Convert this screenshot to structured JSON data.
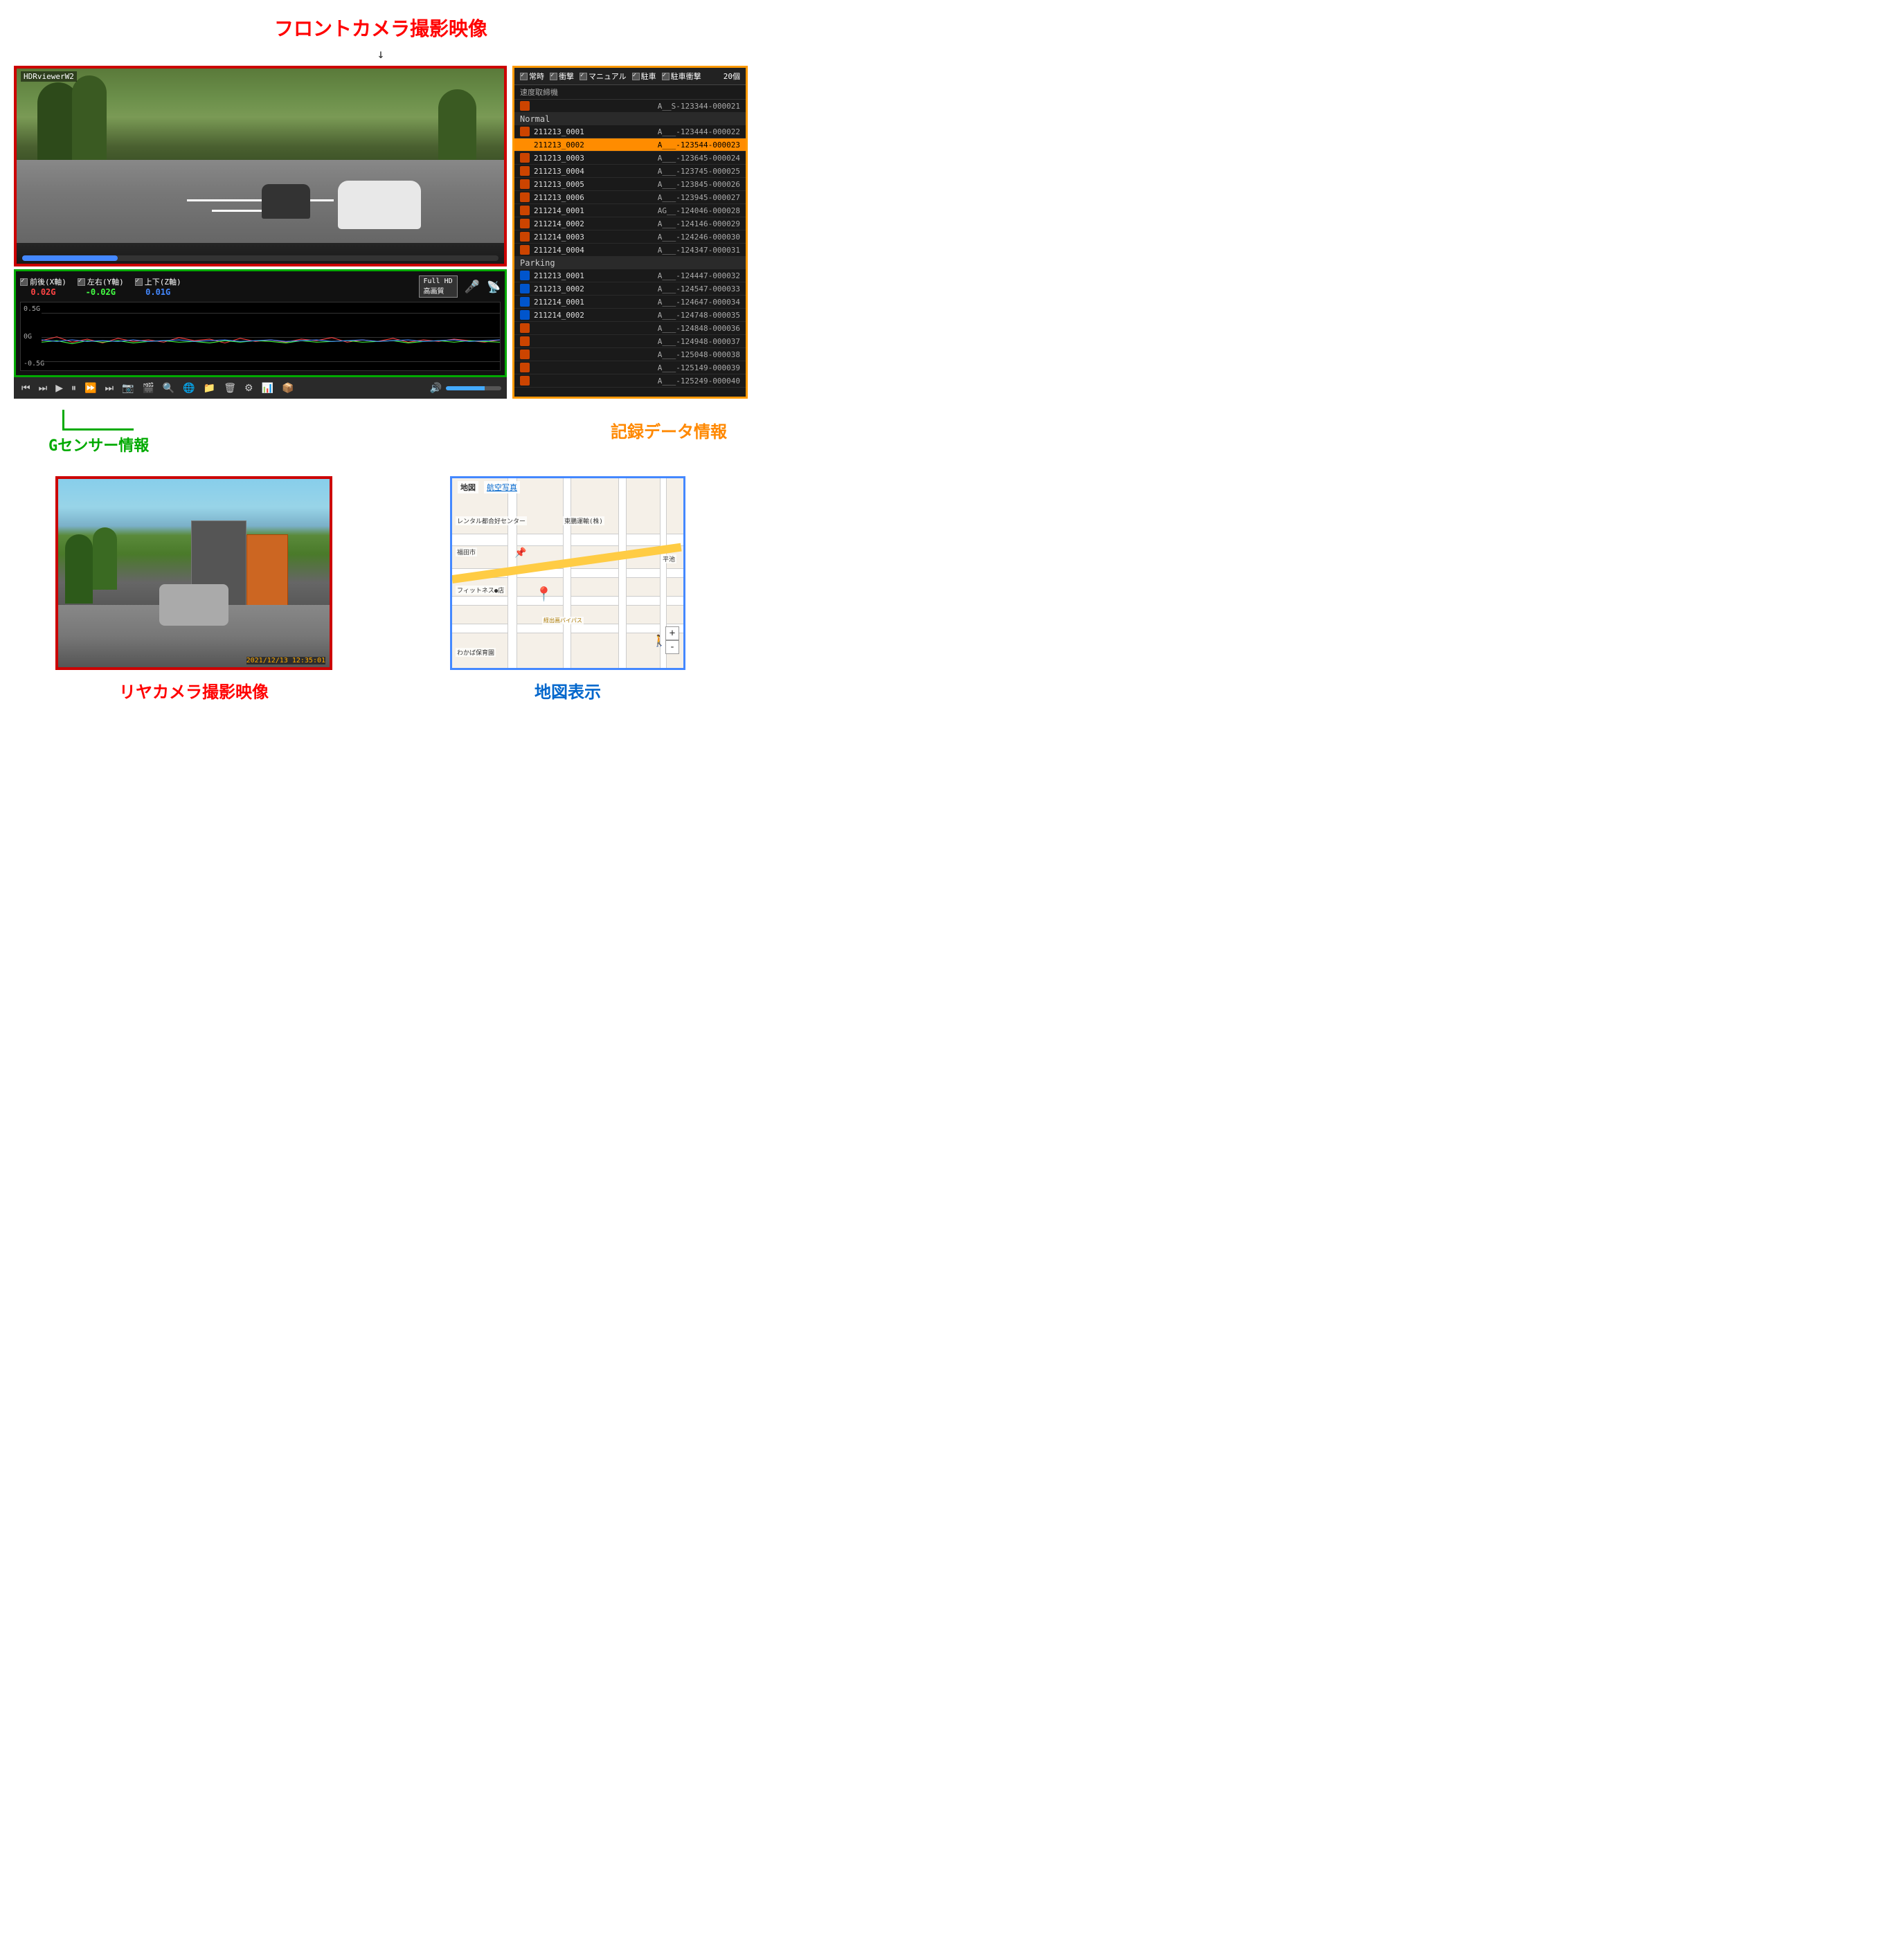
{
  "page": {
    "title": "HDRviewerW2 UI",
    "front_camera_title": "フロントカメラ撮影映像",
    "gsensor_title": "Gセンサー情報",
    "data_title": "記録データ情報",
    "rear_camera_title": "リヤカメラ撮影映像",
    "map_title": "地図表示"
  },
  "front_camera": {
    "label": "HDRviewerW2",
    "arrow": "↓"
  },
  "gsensor": {
    "axis_x_label": "前後(X軸)",
    "axis_y_label": "左右(Y軸)",
    "axis_z_label": "上下(Z軸)",
    "axis_x_value": "0.02G",
    "axis_y_value": "-0.02G",
    "axis_z_value": "0.01G",
    "fullhd_label": "Full HD",
    "kousha_label": "高画質",
    "graph_top": "0.5G",
    "graph_mid": "0G",
    "graph_bot": "-0.5G"
  },
  "transport": {
    "buttons": [
      "⏮",
      "⏭",
      "▶",
      "⏸",
      "⏩",
      "⏭",
      "📷",
      "🎬",
      "🔍",
      "🌐",
      "📁",
      "🗑",
      "⚙",
      "📊",
      "📦"
    ]
  },
  "right_panel": {
    "checkboxes": [
      "常時",
      "衝撃",
      "マニュアル",
      "駐車",
      "駐車衝撃"
    ],
    "count": "20個",
    "speed_device": "速度取締機",
    "normal_label": "Normal",
    "parking_label": "Parking",
    "normal_items": [
      {
        "name": "211213_0001",
        "id": "A___-123444-000022",
        "icon": "red"
      },
      {
        "name": "211213_0002",
        "id": "A___-123544-000023",
        "icon": "orange",
        "selected": true
      },
      {
        "name": "211213_0003",
        "id": "A___-123645-000024",
        "icon": "red"
      },
      {
        "name": "211213_0004",
        "id": "A___-123745-000025",
        "icon": "red"
      },
      {
        "name": "211213_0005",
        "id": "A___-123845-000026",
        "icon": "red"
      },
      {
        "name": "211213_0006",
        "id": "A___-123945-000027",
        "icon": "red"
      },
      {
        "name": "211214_0001",
        "id": "AG__-124046-000028",
        "icon": "red"
      },
      {
        "name": "211214_0002",
        "id": "A___-124146-000029",
        "icon": "red"
      },
      {
        "name": "211214_0003",
        "id": "A___-124246-000030",
        "icon": "red"
      },
      {
        "name": "211214_0004",
        "id": "A___-124347-000031",
        "icon": "red"
      }
    ],
    "first_item": {
      "name": "",
      "id": "A__S-123344-000021",
      "icon": "red"
    },
    "parking_items": [
      {
        "name": "211213_0001",
        "id": "A___-124447-000032",
        "icon": "blue"
      },
      {
        "name": "211213_0002",
        "id": "A___-124547-000033",
        "icon": "blue"
      },
      {
        "name": "211214_0001",
        "id": "A___-124647-000034",
        "icon": "blue"
      },
      {
        "name": "211214_0002",
        "id": "A___-124748-000035",
        "icon": "blue"
      }
    ],
    "extra_items": [
      "A___-124848-000036",
      "A___-124948-000037",
      "A___-125048-000038",
      "A___-125149-000039",
      "A___-125249-000040"
    ]
  },
  "rear_camera": {
    "timestamp": "2021/12/13  12:35:01"
  },
  "map": {
    "tabs": [
      "地図",
      "航空写真"
    ],
    "active_tab": "地図",
    "labels": [
      "レンタル都合好センター",
      "東鵬運輸(株)",
      "福田市",
      "フィットネス●店",
      "わかば保育園"
    ],
    "zoom_plus": "+",
    "zoom_minus": "-"
  },
  "colors": {
    "red": "#cc0000",
    "orange": "#ff8800",
    "green": "#00aa00",
    "blue": "#0066cc",
    "selected_bg": "#ff8c00"
  }
}
